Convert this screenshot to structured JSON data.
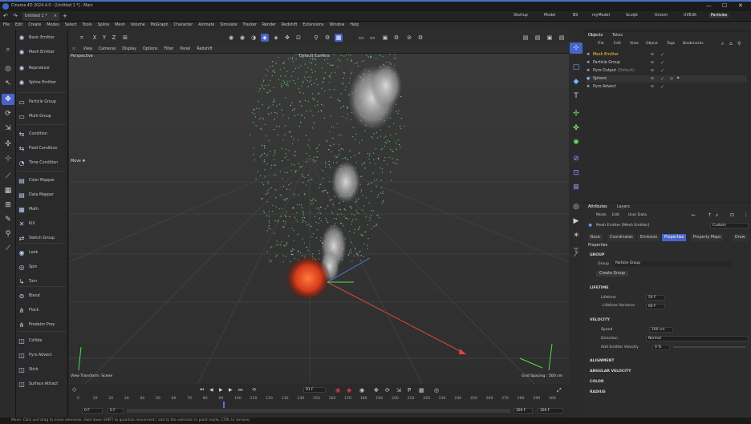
{
  "app": {
    "title": "Cinema 4D 2024.4.0 - [Untitled 1 *] - Main",
    "doc_tab": "Untitled 1 *"
  },
  "layouts": [
    "Startup",
    "Model",
    "BS",
    "myModel",
    "Sculpt",
    "Groom",
    "UVEdit",
    "Particles"
  ],
  "menu": [
    "File",
    "Edit",
    "Create",
    "Modes",
    "Select",
    "Tools",
    "Spline",
    "Mesh",
    "Volume",
    "MoGraph",
    "Character",
    "Animate",
    "Simulate",
    "Tracker",
    "Render",
    "Redshift",
    "Extensions",
    "Window",
    "Help"
  ],
  "axes": [
    "X",
    "Y",
    "Z"
  ],
  "viewport": {
    "menu": [
      "View",
      "Cameras",
      "Display",
      "Options",
      "Filter",
      "Panel",
      "Redshift"
    ],
    "label": "Perspective",
    "camera": "Default Camera",
    "hud_move": "Move ✥",
    "transform": "View Transform: Scene",
    "grid": "Grid Spacing : 500 cm"
  },
  "palette": [
    {
      "label": "Basic Emitter",
      "icon": "✺"
    },
    {
      "label": "Mesh Emitter",
      "icon": "✺"
    },
    {
      "label": "Reproduce",
      "icon": "✺"
    },
    {
      "label": "Spline Emitter",
      "icon": "✺"
    },
    {
      "label": "Particle Group",
      "icon": "▭"
    },
    {
      "label": "Multi Group",
      "icon": "▭"
    },
    {
      "label": "Condition",
      "icon": "⇆"
    },
    {
      "label": "Field Condition",
      "icon": "⇆"
    },
    {
      "label": "Time Condition",
      "icon": "◔"
    },
    {
      "label": "Color Mapper",
      "icon": "▤"
    },
    {
      "label": "Data Mapper",
      "icon": "▤"
    },
    {
      "label": "Math",
      "icon": "▦"
    },
    {
      "label": "Kill",
      "icon": "✕"
    },
    {
      "label": "Switch Group",
      "icon": "⇄"
    },
    {
      "label": "Look",
      "icon": "◉"
    },
    {
      "label": "Spin",
      "icon": "◎"
    },
    {
      "label": "Turn",
      "icon": "↳"
    },
    {
      "label": "Blend",
      "icon": "⊜"
    },
    {
      "label": "Flock",
      "icon": "⋔"
    },
    {
      "label": "Predator Prey",
      "icon": "⋔"
    },
    {
      "label": "Collide",
      "icon": "◫"
    },
    {
      "label": "Pyro Advect",
      "icon": "◫"
    },
    {
      "label": "Stick",
      "icon": "◫"
    },
    {
      "label": "Surface Attract",
      "icon": "◫"
    }
  ],
  "objects": {
    "tabs": [
      "Objects",
      "Takes"
    ],
    "menu": [
      "File",
      "Edit",
      "View",
      "Object",
      "Tags",
      "Bookmarks"
    ],
    "items": [
      {
        "name": "Mesh Emitter",
        "color": "#ffcc33"
      },
      {
        "name": "Particle Group",
        "color": "#cfcfcf"
      },
      {
        "name": "Pyro Output",
        "suffix": "(Default)",
        "color": "#cfcfcf"
      },
      {
        "name": "Sphere",
        "color": "#cfcfcf"
      },
      {
        "name": "Pyro Advect",
        "color": "#cfcfcf"
      }
    ]
  },
  "attributes": {
    "tabs": [
      "Attributes",
      "Layers"
    ],
    "menu": [
      "Mode",
      "Edit",
      "User Data"
    ],
    "object": "Mesh Emitter [Mesh Emitter]",
    "preset": "Custom",
    "prop_tabs": [
      "Basic",
      "Coordinates",
      "Emission",
      "Properties",
      "Property Maps",
      "Draw"
    ],
    "active_tab": "Properties",
    "section": "Properties",
    "group_header": "GROUP",
    "group_label": "Group",
    "group_value": "Particle Group",
    "create_group": "Create Group",
    "lifetime_header": "LIFETIME",
    "lifetime_label": "Lifetime",
    "lifetime_value": "50 F",
    "lifetime_var_label": "Lifetime Variance",
    "lifetime_var_value": "60 F",
    "velocity_header": "VELOCITY",
    "speed_label": "Speed",
    "speed_value": "100 cm",
    "direction_label": "Direction",
    "direction_value": "Normal",
    "add_vel_label": "Add Emitter Velocity",
    "add_vel_value": "0 %",
    "more_headers": [
      "ALIGNMENT",
      "ANGULAR VELOCITY",
      "COLOR",
      "RADIUS"
    ]
  },
  "timeline": {
    "frame": "91 F",
    "start": "0 F",
    "start2": "0 F",
    "end": "300 F",
    "end2": "300 F",
    "ticks": [
      "0",
      "10",
      "20",
      "30",
      "40",
      "50",
      "60",
      "70",
      "80",
      "90",
      "100",
      "110",
      "120",
      "130",
      "140",
      "150",
      "160",
      "170",
      "180",
      "190",
      "200",
      "210",
      "220",
      "230",
      "240",
      "250",
      "260",
      "270",
      "280",
      "290",
      "300"
    ]
  },
  "status": "Move: Click and drag to move elements. Hold down SHIFT to quantize movement / add to the selection in point mode, CTRL to remove."
}
